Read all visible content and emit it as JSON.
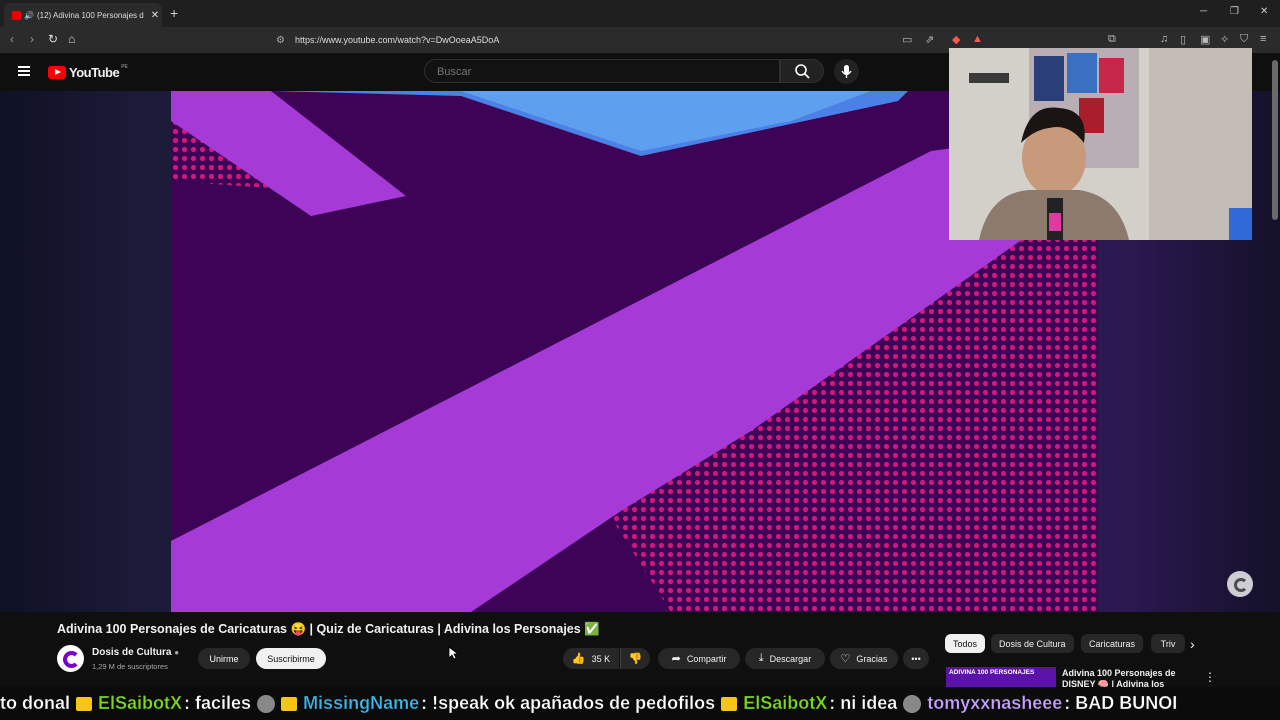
{
  "browser": {
    "tab_title": "(12) Adivina 100 Personajes d",
    "url": "https://www.youtube.com/watch?v=DwOoeaA5DoA"
  },
  "youtube": {
    "logo_text": "YouTube",
    "country_code": "PE",
    "search_placeholder": "Buscar"
  },
  "video": {
    "title": "Adivina 100 Personajes de Caricaturas 😝 | Quiz de Caricaturas | Adivina los Personajes ✅",
    "channel_name": "Dosis de Cultura",
    "subscribers": "1,29 M de suscriptores",
    "join_label": "Unirme",
    "subscribe_label": "Suscribirme",
    "likes": "35 K",
    "share_label": "Compartir",
    "download_label": "Descargar",
    "thanks_label": "Gracias"
  },
  "filters": [
    "Todos",
    "Dosis de Cultura",
    "Caricaturas",
    "Triv"
  ],
  "recommended": {
    "thumb_text": "ADIVINA 100 PERSONAJES",
    "title": "Adivina 100 Personajes de DISNEY 🧠 | Adivina los"
  },
  "chat_ticker": [
    {
      "user": "",
      "message": "to donal"
    },
    {
      "user": "ElSaibotX",
      "message": ": faciles"
    },
    {
      "user": "MissingName",
      "message": ": !speak ok apañados de pedofilos"
    },
    {
      "user": "ElSaibotX",
      "message": ": ni idea"
    },
    {
      "user": "tomyxxnasheee",
      "message": ": BAD BUNOI"
    }
  ],
  "colors": {
    "chat_green": "#7cd81f",
    "chat_blue": "#3fb6e8",
    "chat_purple": "#c7a3ff",
    "video_purple": "#a63ad6",
    "video_dark": "#3c0357"
  }
}
